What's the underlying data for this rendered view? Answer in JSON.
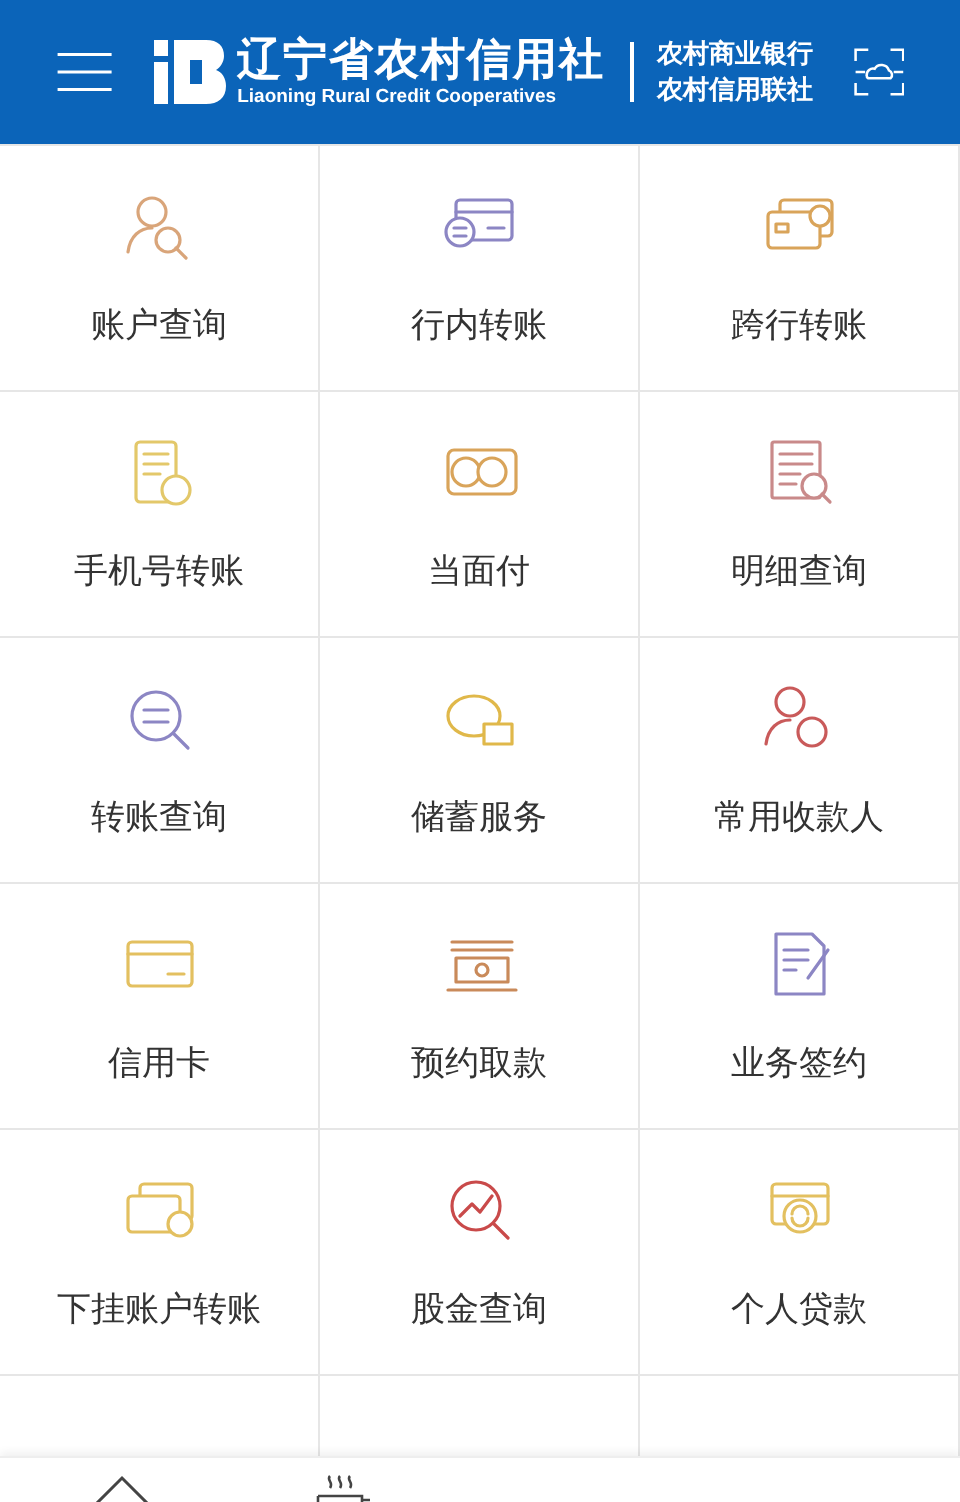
{
  "header": {
    "logo_title": "辽宁省农村信用社",
    "logo_subtitle": "Liaoning Rural Credit Cooperatives",
    "bank_names": [
      "农村商业银行",
      "农村信用联社"
    ]
  },
  "services": [
    {
      "label": "账户查询"
    },
    {
      "label": "行内转账"
    },
    {
      "label": "跨行转账"
    },
    {
      "label": "手机号转账"
    },
    {
      "label": "当面付"
    },
    {
      "label": "明细查询"
    },
    {
      "label": "转账查询"
    },
    {
      "label": "储蓄服务"
    },
    {
      "label": "常用收款人"
    },
    {
      "label": "信用卡"
    },
    {
      "label": "预约取款"
    },
    {
      "label": "业务签约"
    },
    {
      "label": "下挂账户转账"
    },
    {
      "label": "股金查询"
    },
    {
      "label": "个人贷款"
    }
  ]
}
